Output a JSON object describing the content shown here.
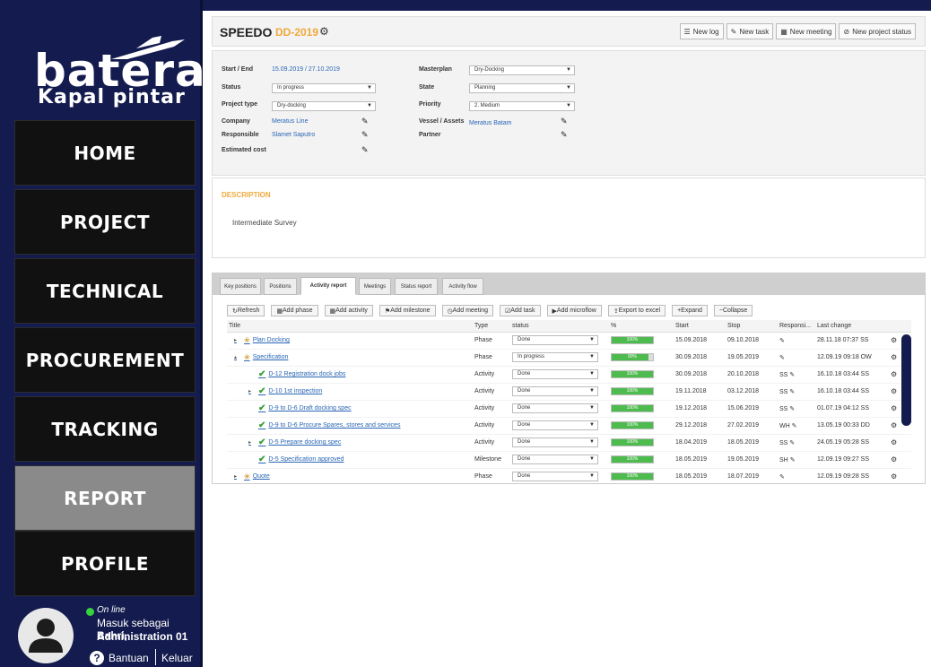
{
  "logo": {
    "brand": "batera",
    "tagline": "Kapal pintar"
  },
  "nav": [
    {
      "label": "HOME",
      "active": false
    },
    {
      "label": "PROJECT",
      "active": false
    },
    {
      "label": "TECHNICAL",
      "active": false
    },
    {
      "label": "PROCUREMENT",
      "active": false
    },
    {
      "label": "TRACKING",
      "active": false
    },
    {
      "label": "REPORT",
      "active": true
    },
    {
      "label": "PROFILE",
      "active": false
    }
  ],
  "user": {
    "status": "On line",
    "login_prefix": "Masuk sebagai ",
    "name": "Bahri,",
    "role": "Administration 01",
    "help": "Bantuan",
    "logout": "Keluar"
  },
  "header": {
    "project_name": "SPEEDO",
    "project_code": "DD-2019",
    "toolbar": [
      "New log",
      "New task",
      "New meeting",
      "New project status"
    ]
  },
  "details": {
    "start_end": {
      "label": "Start / End",
      "value": "15.09.2019 / 27.10.2019"
    },
    "status": {
      "label": "Status",
      "value": "In progress"
    },
    "project_type": {
      "label": "Project type",
      "value": "Dry-docking"
    },
    "company": {
      "label": "Company",
      "value": "Meratus Line"
    },
    "responsible": {
      "label": "Responsible",
      "value": "Slamet Saputro"
    },
    "estimated_cost": {
      "label": "Estimated cost",
      "value": ""
    },
    "masterplan": {
      "label": "Masterplan",
      "value": "Dry-Docking"
    },
    "state": {
      "label": "State",
      "value": "Planning"
    },
    "priority": {
      "label": "Priority",
      "value": "2. Medium"
    },
    "vessel": {
      "label": "Vessel / Assets",
      "value": "Meratus Batam"
    },
    "partner": {
      "label": "Partner",
      "value": ""
    }
  },
  "description": {
    "title": "DESCRIPTION",
    "text": "Intermediate Survey"
  },
  "tabs": [
    {
      "label": "Key positions",
      "active": false
    },
    {
      "label": "Positions",
      "active": false
    },
    {
      "label": "Activity report",
      "active": true
    },
    {
      "label": "Meetings",
      "active": false
    },
    {
      "label": "Status report",
      "active": false
    },
    {
      "label": "Activity flow",
      "active": false
    }
  ],
  "actions": [
    "Refresh",
    "Add phase",
    "Add activity",
    "Add milestone",
    "Add meeting",
    "Add task",
    "Add microflow",
    "Export to excel",
    "Expand",
    "Collapse"
  ],
  "grid": {
    "columns": [
      "Title",
      "Type",
      "status",
      "%",
      "Start",
      "Stop",
      "Responsi...",
      "Last change"
    ],
    "rows": [
      {
        "title": "Plan Docking",
        "kind": "phase",
        "expander": "right",
        "type": "Phase",
        "status": "Done",
        "pct": 100,
        "pct_label": "100%",
        "start": "15.09.2018",
        "stop": "09.10.2018",
        "resp": "",
        "last": "28.11.18 07:37 SS"
      },
      {
        "title": "Specification",
        "kind": "phase",
        "expander": "down",
        "type": "Phase",
        "status": "In progress",
        "pct": 90,
        "pct_label": "90%",
        "start": "30.09.2018",
        "stop": "19.05.2019",
        "resp": "",
        "last": "12.09.19 09:18 OW"
      },
      {
        "title": "D-12 Registration dock jobs",
        "kind": "activity",
        "expander": "none",
        "type": "Activity",
        "status": "Done",
        "pct": 100,
        "pct_label": "100%",
        "start": "30.09.2018",
        "stop": "20.10.2018",
        "resp": "SS",
        "last": "16.10.18 03:44 SS"
      },
      {
        "title": "D-10 1st inspection",
        "kind": "activity",
        "expander": "right",
        "type": "Activity",
        "status": "Done",
        "pct": 100,
        "pct_label": "100%",
        "start": "19.11.2018",
        "stop": "03.12.2018",
        "resp": "SS",
        "last": "16.10.18 03:44 SS"
      },
      {
        "title": "D-9 to D-6 Draft docking spec",
        "kind": "activity",
        "expander": "none",
        "type": "Activity",
        "status": "Done",
        "pct": 100,
        "pct_label": "100%",
        "start": "19.12.2018",
        "stop": "15.06.2019",
        "resp": "SS",
        "last": "01.07.19 04:12 SS"
      },
      {
        "title": "D-9 to D-6 Procure Spares, stores and services",
        "kind": "activity",
        "expander": "none",
        "type": "Activity",
        "status": "Done",
        "pct": 100,
        "pct_label": "100%",
        "start": "29.12.2018",
        "stop": "27.02.2019",
        "resp": "WH",
        "last": "13.05.19 00:33 DD"
      },
      {
        "title": "D-5 Prepare docking spec",
        "kind": "activity",
        "expander": "right",
        "type": "Activity",
        "status": "Done",
        "pct": 100,
        "pct_label": "100%",
        "start": "18.04.2019",
        "stop": "18.05.2019",
        "resp": "SS",
        "last": "24.05.19 05:28 SS"
      },
      {
        "title": "D-5 Specification approved",
        "kind": "activity",
        "expander": "none",
        "type": "Milestone",
        "status": "Done",
        "pct": 100,
        "pct_label": "100%",
        "start": "18.05.2019",
        "stop": "19.05.2019",
        "resp": "SH",
        "last": "12.09.19 09:27 SS"
      },
      {
        "title": "Quote",
        "kind": "phase",
        "expander": "right",
        "type": "Phase",
        "status": "Done",
        "pct": 100,
        "pct_label": "100%",
        "start": "18.05.2019",
        "stop": "18.07.2019",
        "resp": "",
        "last": "12.09.19 09:28 SS"
      }
    ]
  },
  "colors": {
    "navy": "#141c4f",
    "accent": "#f0a93b",
    "link": "#2a66b5",
    "progress": "#4dbb4d",
    "online": "#37d23d"
  }
}
